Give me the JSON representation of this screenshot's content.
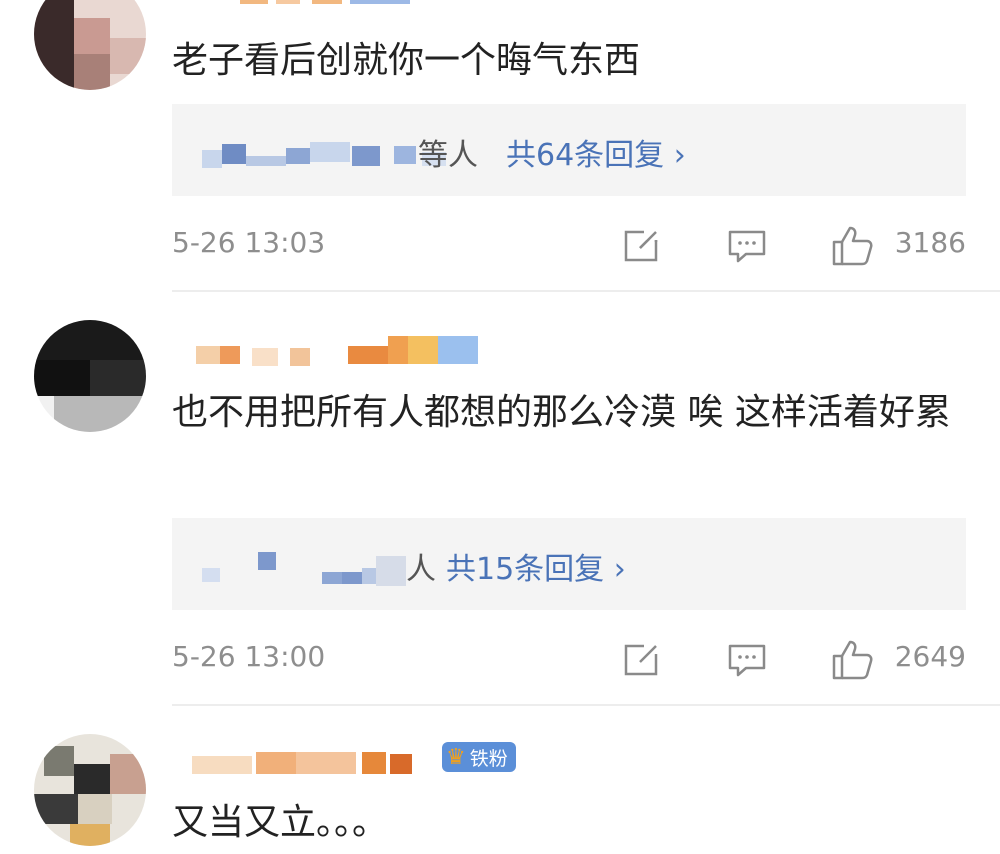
{
  "comments": [
    {
      "text": "老子看后创就你一个晦气东西",
      "reply_suffix": "等人",
      "reply_count": "共64条回复 ›",
      "time": "5-26 13:03",
      "likes": "3186"
    },
    {
      "text": "也不用把所有人都想的那么冷漠 唉 这样活着好累",
      "reply_suffix": "人",
      "reply_count": "共15条回复 ›",
      "time": "5-26 13:00",
      "likes": "2649"
    },
    {
      "badge": "铁粉",
      "text": "又当又立。。。"
    }
  ],
  "icons": {
    "share": "share-icon",
    "comment": "comment-icon",
    "like": "thumbs-up-icon",
    "badge": "crown-icon"
  },
  "colors": {
    "link": "#4a73b7",
    "meta": "#8e8e8e",
    "reply_bg": "#f4f4f4",
    "badge": "#5b8fd8"
  }
}
